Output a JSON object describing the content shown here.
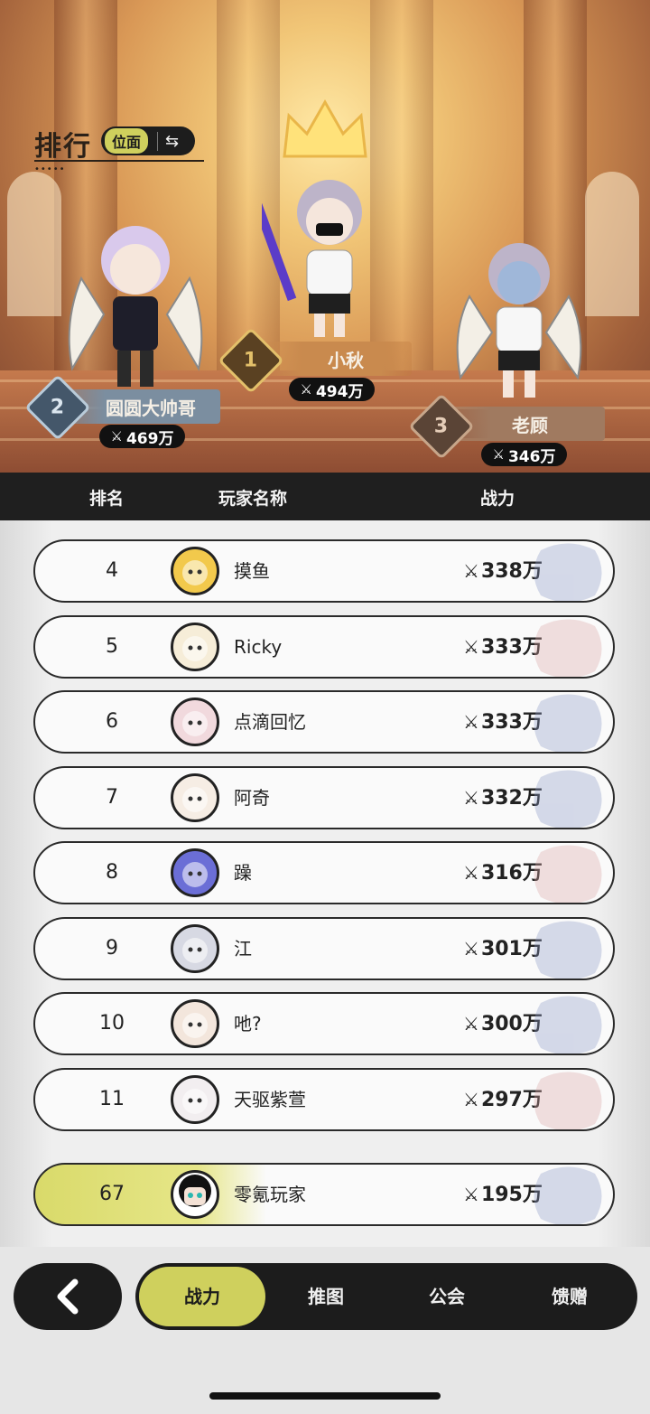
{
  "header": {
    "title": "排行",
    "scope_label": "位面",
    "scope_switch_icon": "swap-icon"
  },
  "podium": [
    {
      "rank": "1",
      "name": "小秋",
      "power": "494万"
    },
    {
      "rank": "2",
      "name": "圆圆大帅哥",
      "power": "469万"
    },
    {
      "rank": "3",
      "name": "老顾",
      "power": "346万"
    }
  ],
  "table": {
    "columns": [
      "排名",
      "玩家名称",
      "战力"
    ]
  },
  "rows": [
    {
      "rank": "4",
      "name": "摸鱼",
      "power": "338万"
    },
    {
      "rank": "5",
      "name": "Ricky",
      "power": "333万"
    },
    {
      "rank": "6",
      "name": "点滴回忆",
      "power": "333万"
    },
    {
      "rank": "7",
      "name": "阿奇",
      "power": "332万"
    },
    {
      "rank": "8",
      "name": "躁",
      "power": "316万"
    },
    {
      "rank": "9",
      "name": "江",
      "power": "301万"
    },
    {
      "rank": "10",
      "name": "吔?",
      "power": "300万"
    },
    {
      "rank": "11",
      "name": "天驱紫萱",
      "power": "297万"
    }
  ],
  "self": {
    "rank": "67",
    "name": "零氪玩家",
    "power": "195万"
  },
  "nav": {
    "back_icon": "chevron-left-icon",
    "tabs": [
      "战力",
      "推图",
      "公会",
      "馈赠"
    ],
    "active_tab": "战力"
  },
  "colors": {
    "accent": "#cfd05d",
    "dark": "#1c1c1c",
    "gold_badge": "#c9a23b",
    "silver_badge": "#8aa3b8",
    "bronze_badge": "#8a6a54"
  },
  "power_icon": "crossed-swords-icon"
}
